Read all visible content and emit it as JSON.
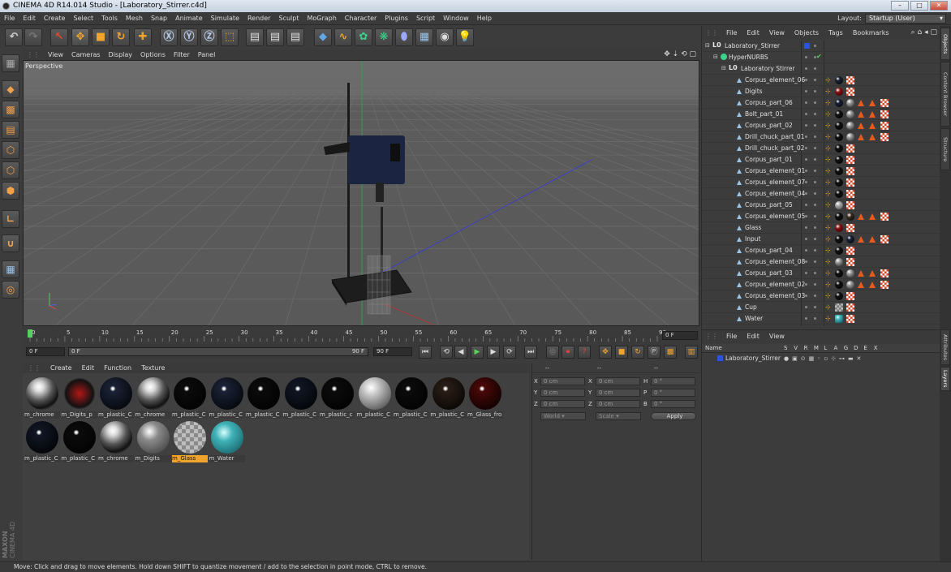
{
  "window": {
    "title": "CINEMA 4D R14.014 Studio - [Laboratory_Stirrer.c4d]"
  },
  "menu": [
    "File",
    "Edit",
    "Create",
    "Select",
    "Tools",
    "Mesh",
    "Snap",
    "Animate",
    "Simulate",
    "Render",
    "Sculpt",
    "MoGraph",
    "Character",
    "Plugins",
    "Script",
    "Window",
    "Help"
  ],
  "layout": {
    "label": "Layout:",
    "value": "Startup (User)"
  },
  "viewport": {
    "menu": [
      "View",
      "Cameras",
      "Display",
      "Options",
      "Filter",
      "Panel"
    ],
    "label": "Perspective"
  },
  "timeline": {
    "ticks": [
      "0",
      "5",
      "10",
      "15",
      "20",
      "25",
      "30",
      "35",
      "40",
      "45",
      "50",
      "55",
      "60",
      "65",
      "70",
      "75",
      "80",
      "85",
      "90"
    ],
    "current_frame": "0 F",
    "start_frame": "0 F",
    "range_start": "0 F",
    "range_end": "90 F",
    "end_frame": "90 F"
  },
  "materials": {
    "menu": [
      "Create",
      "Edit",
      "Function",
      "Texture"
    ],
    "items": [
      {
        "name": "m_chrome",
        "color": "#c8c8c8",
        "style": "chrome"
      },
      {
        "name": "m_Digits_p",
        "color": "#b01818",
        "style": "digits"
      },
      {
        "name": "m_plastic_C",
        "color": "#1a2236",
        "style": "dark"
      },
      {
        "name": "m_chrome",
        "color": "#c8c8c8",
        "style": "chrome"
      },
      {
        "name": "m_plastic_C",
        "color": "#0b0b0b",
        "style": "black"
      },
      {
        "name": "m_plastic_C",
        "color": "#1a2236",
        "style": "dark"
      },
      {
        "name": "m_plastic_C",
        "color": "#0b0b0b",
        "style": "black"
      },
      {
        "name": "m_plastic_C",
        "color": "#101624",
        "style": "dark"
      },
      {
        "name": "m_plastic_c",
        "color": "#0b0b0b",
        "style": "black"
      },
      {
        "name": "m_plastic_C",
        "color": "#bdbdbd",
        "style": "grey"
      },
      {
        "name": "m_plastic_C",
        "color": "#0b0b0b",
        "style": "black"
      },
      {
        "name": "m_plastic_C",
        "color": "#2a1d16",
        "style": "brown"
      },
      {
        "name": "m_Glass_fro",
        "color": "#4a0808",
        "style": "red"
      },
      {
        "name": "m_plastic_C",
        "color": "#101624",
        "style": "dark"
      },
      {
        "name": "m_plastic_C",
        "color": "#0b0b0b",
        "style": "black"
      },
      {
        "name": "m_chrome",
        "color": "#c8c8c8",
        "style": "chrome"
      },
      {
        "name": "m_Digits",
        "color": "#8a8a8a",
        "style": "grey"
      },
      {
        "name": "m_Glass",
        "color": "#9a9a9a",
        "style": "glass",
        "selected": true
      },
      {
        "name": "m_Water",
        "color": "#3fb2b8",
        "style": "water"
      }
    ]
  },
  "coords": {
    "headers": [
      "--",
      "--",
      "--"
    ],
    "rows": [
      {
        "a": "X",
        "av": "0 cm",
        "b": "X",
        "bv": "0 cm",
        "c": "H",
        "cv": "0 °"
      },
      {
        "a": "Y",
        "av": "0 cm",
        "b": "Y",
        "bv": "0 cm",
        "c": "P",
        "cv": "0 °"
      },
      {
        "a": "Z",
        "av": "0 cm",
        "b": "Z",
        "bv": "0 cm",
        "c": "B",
        "cv": "0 °"
      }
    ],
    "mode": "World",
    "scale": "Scale",
    "apply": "Apply"
  },
  "object_manager": {
    "menu": [
      "File",
      "Edit",
      "View",
      "Objects",
      "Tags",
      "Bookmarks"
    ],
    "objects": [
      {
        "name": "Laboratory_Stirrer",
        "depth": 0,
        "kind": "null",
        "tags": []
      },
      {
        "name": "HyperNURBS",
        "depth": 1,
        "kind": "nurbs",
        "tags": []
      },
      {
        "name": "Laboratory Stirrer",
        "depth": 2,
        "kind": "null",
        "tags": []
      },
      {
        "name": "Corpus_element_06",
        "depth": 3,
        "kind": "poly",
        "tags": [
          "dark",
          "chk"
        ]
      },
      {
        "name": "Digits",
        "depth": 3,
        "kind": "poly",
        "tags": [
          "red",
          "chk"
        ]
      },
      {
        "name": "Corpus_part_06",
        "depth": 3,
        "kind": "poly",
        "tags": [
          "dark",
          "chrome",
          "tri",
          "tri",
          "chk"
        ]
      },
      {
        "name": "Bolt_part_01",
        "depth": 3,
        "kind": "poly",
        "tags": [
          "black",
          "chrome",
          "tri",
          "tri",
          "chk"
        ]
      },
      {
        "name": "Corpus_part_02",
        "depth": 3,
        "kind": "poly",
        "tags": [
          "black",
          "chrome",
          "tri",
          "tri",
          "chk"
        ]
      },
      {
        "name": "Drill_chuck_part_01",
        "depth": 3,
        "kind": "poly",
        "tags": [
          "black",
          "chrome",
          "tri",
          "tri",
          "chk"
        ]
      },
      {
        "name": "Drill_chuck_part_02",
        "depth": 3,
        "kind": "poly",
        "tags": [
          "black",
          "chk"
        ]
      },
      {
        "name": "Corpus_part_01",
        "depth": 3,
        "kind": "poly",
        "tags": [
          "black",
          "chk"
        ]
      },
      {
        "name": "Corpus_element_01",
        "depth": 3,
        "kind": "poly",
        "tags": [
          "black",
          "chk"
        ]
      },
      {
        "name": "Corpus_element_07",
        "depth": 3,
        "kind": "poly",
        "tags": [
          "black",
          "chk"
        ]
      },
      {
        "name": "Corpus_element_04",
        "depth": 3,
        "kind": "poly",
        "tags": [
          "black",
          "chk"
        ]
      },
      {
        "name": "Corpus_part_05",
        "depth": 3,
        "kind": "poly",
        "tags": [
          "grey",
          "chk"
        ]
      },
      {
        "name": "Corpus_element_05",
        "depth": 3,
        "kind": "poly",
        "tags": [
          "black",
          "brown",
          "tri",
          "tri",
          "chk"
        ]
      },
      {
        "name": "Glass",
        "depth": 3,
        "kind": "poly",
        "tags": [
          "red",
          "chk"
        ]
      },
      {
        "name": "Input",
        "depth": 3,
        "kind": "poly",
        "tags": [
          "black",
          "dark",
          "tri",
          "tri",
          "chk"
        ]
      },
      {
        "name": "Corpus_part_04",
        "depth": 3,
        "kind": "poly",
        "tags": [
          "black",
          "chk"
        ]
      },
      {
        "name": "Corpus_element_08",
        "depth": 3,
        "kind": "poly",
        "tags": [
          "chrome",
          "chk"
        ]
      },
      {
        "name": "Corpus_part_03",
        "depth": 3,
        "kind": "poly",
        "tags": [
          "black",
          "chrome",
          "tri",
          "tri",
          "chk"
        ]
      },
      {
        "name": "Corpus_element_02",
        "depth": 3,
        "kind": "poly",
        "tags": [
          "black",
          "chrome",
          "tri",
          "tri",
          "chk"
        ]
      },
      {
        "name": "Corpus_element_03",
        "depth": 3,
        "kind": "poly",
        "tags": [
          "black",
          "chk"
        ]
      },
      {
        "name": "Cup",
        "depth": 3,
        "kind": "poly",
        "tags": [
          "glass",
          "chk"
        ]
      },
      {
        "name": "Water",
        "depth": 3,
        "kind": "poly",
        "tags": [
          "water",
          "chk"
        ]
      }
    ]
  },
  "side_tabs": [
    "Objects",
    "Content Browser",
    "Structure"
  ],
  "side_tabs_lower": [
    "Attributes",
    "Layers"
  ],
  "layers": {
    "menu": [
      "File",
      "Edit",
      "View"
    ],
    "columns": [
      "Name",
      "S",
      "V",
      "R",
      "M",
      "L",
      "A",
      "G",
      "D",
      "E",
      "X"
    ],
    "rows": [
      {
        "name": "Laboratory_Stirrer",
        "color": "#2a55d8"
      }
    ]
  },
  "status": "Move: Click and drag to move elements. Hold down SHIFT to quantize movement / add to the selection in point mode, CTRL to remove.",
  "brand": {
    "line1": "MAXON",
    "line2": "CINEMA 4D"
  }
}
